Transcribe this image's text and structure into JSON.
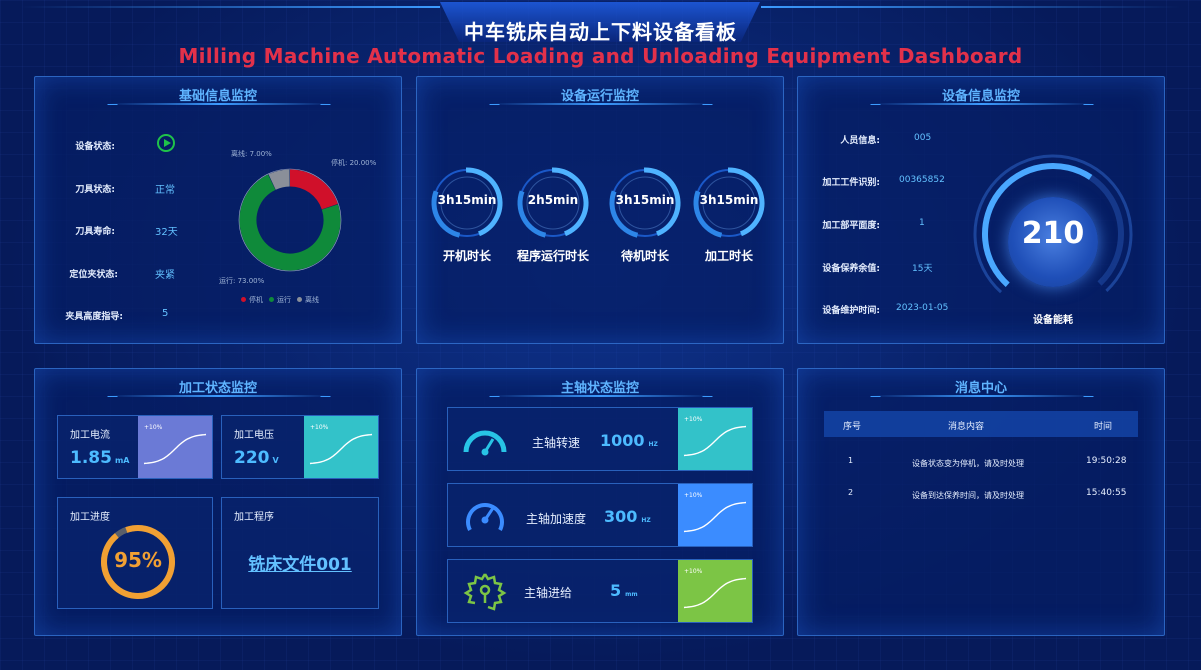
{
  "header": {
    "title_cn": "中车铣床自动上下料设备看板",
    "title_en": "Milling Machine Automatic Loading and Unloading Equipment Dashboard"
  },
  "basic_info": {
    "title": "基础信息监控",
    "rows": [
      {
        "label": "设备状态:",
        "value": ""
      },
      {
        "label": "刀具状态:",
        "value": "正常"
      },
      {
        "label": "刀具寿命:",
        "value": "32天"
      },
      {
        "label": "定位夹状态:",
        "value": "夹紧"
      },
      {
        "label": "夹具高度指导:",
        "value": "5"
      }
    ],
    "status_icon": "play-circle-icon",
    "donut": {
      "slices": [
        {
          "name": "停机",
          "value": 20,
          "label": "停机: 20.00%",
          "color": "#d0102a"
        },
        {
          "name": "运行",
          "value": 73,
          "label": "运行: 73.00%",
          "color": "#0f8a3a"
        },
        {
          "name": "离线",
          "value": 7,
          "label": "离线: 7.00%",
          "color": "#8a8f99"
        }
      ],
      "legend": [
        "停机",
        "运行",
        "离线"
      ]
    }
  },
  "runtime": {
    "title": "设备运行监控",
    "items": [
      {
        "value": "3h15min",
        "label": "开机时长"
      },
      {
        "value": "2h5min",
        "label": "程序运行时长"
      },
      {
        "value": "3h15min",
        "label": "待机时长"
      },
      {
        "value": "3h15min",
        "label": "加工时长"
      }
    ]
  },
  "device_info": {
    "title": "设备信息监控",
    "rows": [
      {
        "label": "人员信息:",
        "value": "005"
      },
      {
        "label": "加工工件识别:",
        "value": "00365852"
      },
      {
        "label": "加工部平面度:",
        "value": "1"
      },
      {
        "label": "设备保养余值:",
        "value": "15天"
      },
      {
        "label": "设备维护时间:",
        "value": "2023-01-05"
      }
    ],
    "gauge": {
      "value": "210",
      "caption": "设备能耗"
    }
  },
  "process": {
    "title": "加工状态监控",
    "current": {
      "label": "加工电流",
      "value": "1.85",
      "unit": "mA",
      "tag": "+10%",
      "color": "#6b7ad6"
    },
    "voltage": {
      "label": "加工电压",
      "value": "220",
      "unit": "V",
      "tag": "+10%",
      "color": "#33c2c9"
    },
    "progress": {
      "label": "加工进度",
      "value": "95%",
      "fraction": 0.95
    },
    "program": {
      "label": "加工程序",
      "value": "铣床文件001"
    }
  },
  "spindle": {
    "title": "主轴状态监控",
    "rows": [
      {
        "icon": "speedometer-icon",
        "label": "主轴转速",
        "value": "1000",
        "unit": "HZ",
        "tag": "+10%",
        "color": "#33c2c9"
      },
      {
        "icon": "gauge-icon",
        "label": "主轴加速度",
        "value": "300",
        "unit": "HZ",
        "tag": "+10%",
        "color": "#3b8cff"
      },
      {
        "icon": "gear-icon",
        "label": "主轴进给",
        "value": "5",
        "unit": "mm",
        "tag": "+10%",
        "color": "#7cc545"
      }
    ]
  },
  "messages": {
    "title": "消息中心",
    "columns": [
      "序号",
      "消息内容",
      "时间"
    ],
    "rows": [
      {
        "no": "1",
        "content": "设备状态变为停机，请及时处理",
        "time": "19:50:28"
      },
      {
        "no": "2",
        "content": "设备到达保养时间，请及时处理",
        "time": "15:40:55"
      }
    ]
  }
}
